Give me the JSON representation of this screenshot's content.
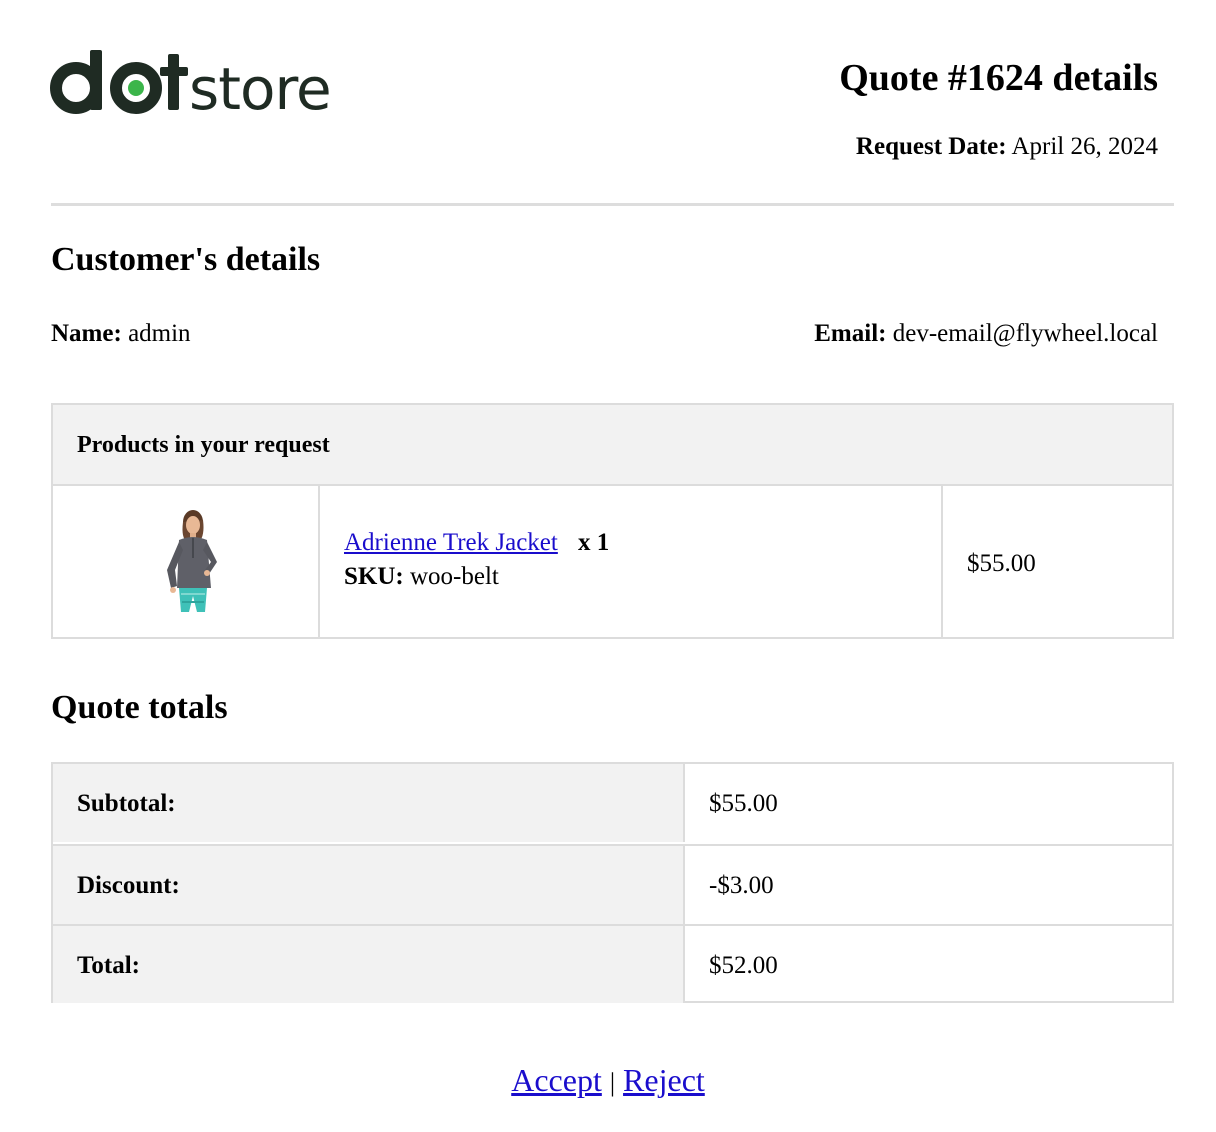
{
  "brand": {
    "logo_text_part1": "do",
    "logo_text_part2": "t",
    "logo_text_part3": "store",
    "dark_color": "#1f2b23",
    "accent_color": "#3bb54a"
  },
  "header": {
    "quote_title": "Quote #1624 details",
    "request_date_label": "Request Date:",
    "request_date_value": "April 26, 2024"
  },
  "customer": {
    "section_title": "Customer's details",
    "name_label": "Name:",
    "name_value": "admin",
    "email_label": "Email:",
    "email_value": "dev-email@flywheel.local"
  },
  "products": {
    "header": "Products in your request",
    "items": [
      {
        "name": "Adrienne Trek Jacket",
        "quantity": "x 1",
        "sku_label": "SKU:",
        "sku_value": "woo-belt",
        "price": "$55.00",
        "image_icon": "product-jacket-photo"
      }
    ]
  },
  "totals": {
    "section_title": "Quote totals",
    "rows": [
      {
        "label": "Subtotal:",
        "value": "$55.00"
      },
      {
        "label": "Discount:",
        "value": "-$3.00"
      },
      {
        "label": "Total:",
        "value": "$52.00"
      }
    ]
  },
  "actions": {
    "accept_label": "Accept",
    "separator": "|",
    "reject_label": "Reject",
    "link_color": "#1a0dcc"
  }
}
